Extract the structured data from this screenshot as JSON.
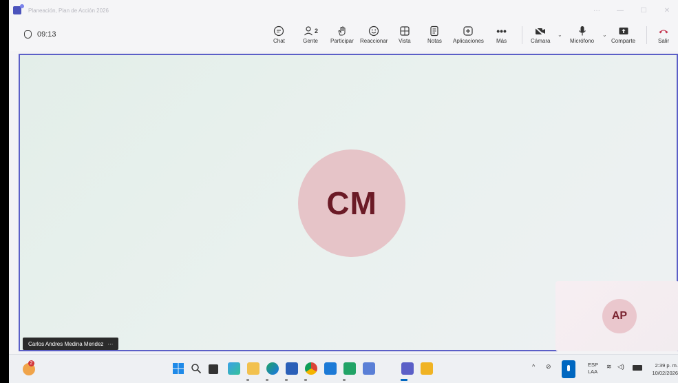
{
  "window": {
    "title": "Planeación, Plan de Acción 2026",
    "controls": [
      "···",
      "—",
      "☐",
      "✕"
    ]
  },
  "toolbar": {
    "timer": "09:13",
    "people_count": "2",
    "buttons": [
      {
        "label": "Chat",
        "icon": "chat-icon"
      },
      {
        "label": "Gente",
        "icon": "people-icon"
      },
      {
        "label": "Participar",
        "icon": "raise-hand-icon"
      },
      {
        "label": "Reaccionar",
        "icon": "smiley-icon"
      },
      {
        "label": "Vista",
        "icon": "grid-icon"
      },
      {
        "label": "Notas",
        "icon": "notes-icon"
      },
      {
        "label": "Aplicaciones",
        "icon": "plus-icon"
      },
      {
        "label": "Más",
        "icon": "more-icon"
      }
    ],
    "camera": "Cámara",
    "microphone": "Micrófono",
    "share": "Comparte",
    "leave": "Salir"
  },
  "stage": {
    "main_initials": "CM",
    "main_name": "Carlos Andres Medina Mendez",
    "name_more": "···",
    "self_initials": "AP"
  },
  "taskbar": {
    "weather_badge": "2",
    "lang_top": "ESP",
    "lang_bottom": "LAA",
    "time": "2:39 p. m.",
    "date": "10/02/2026",
    "colors": {
      "accent": "#5b5fc7",
      "leave": "#c4314b"
    }
  }
}
